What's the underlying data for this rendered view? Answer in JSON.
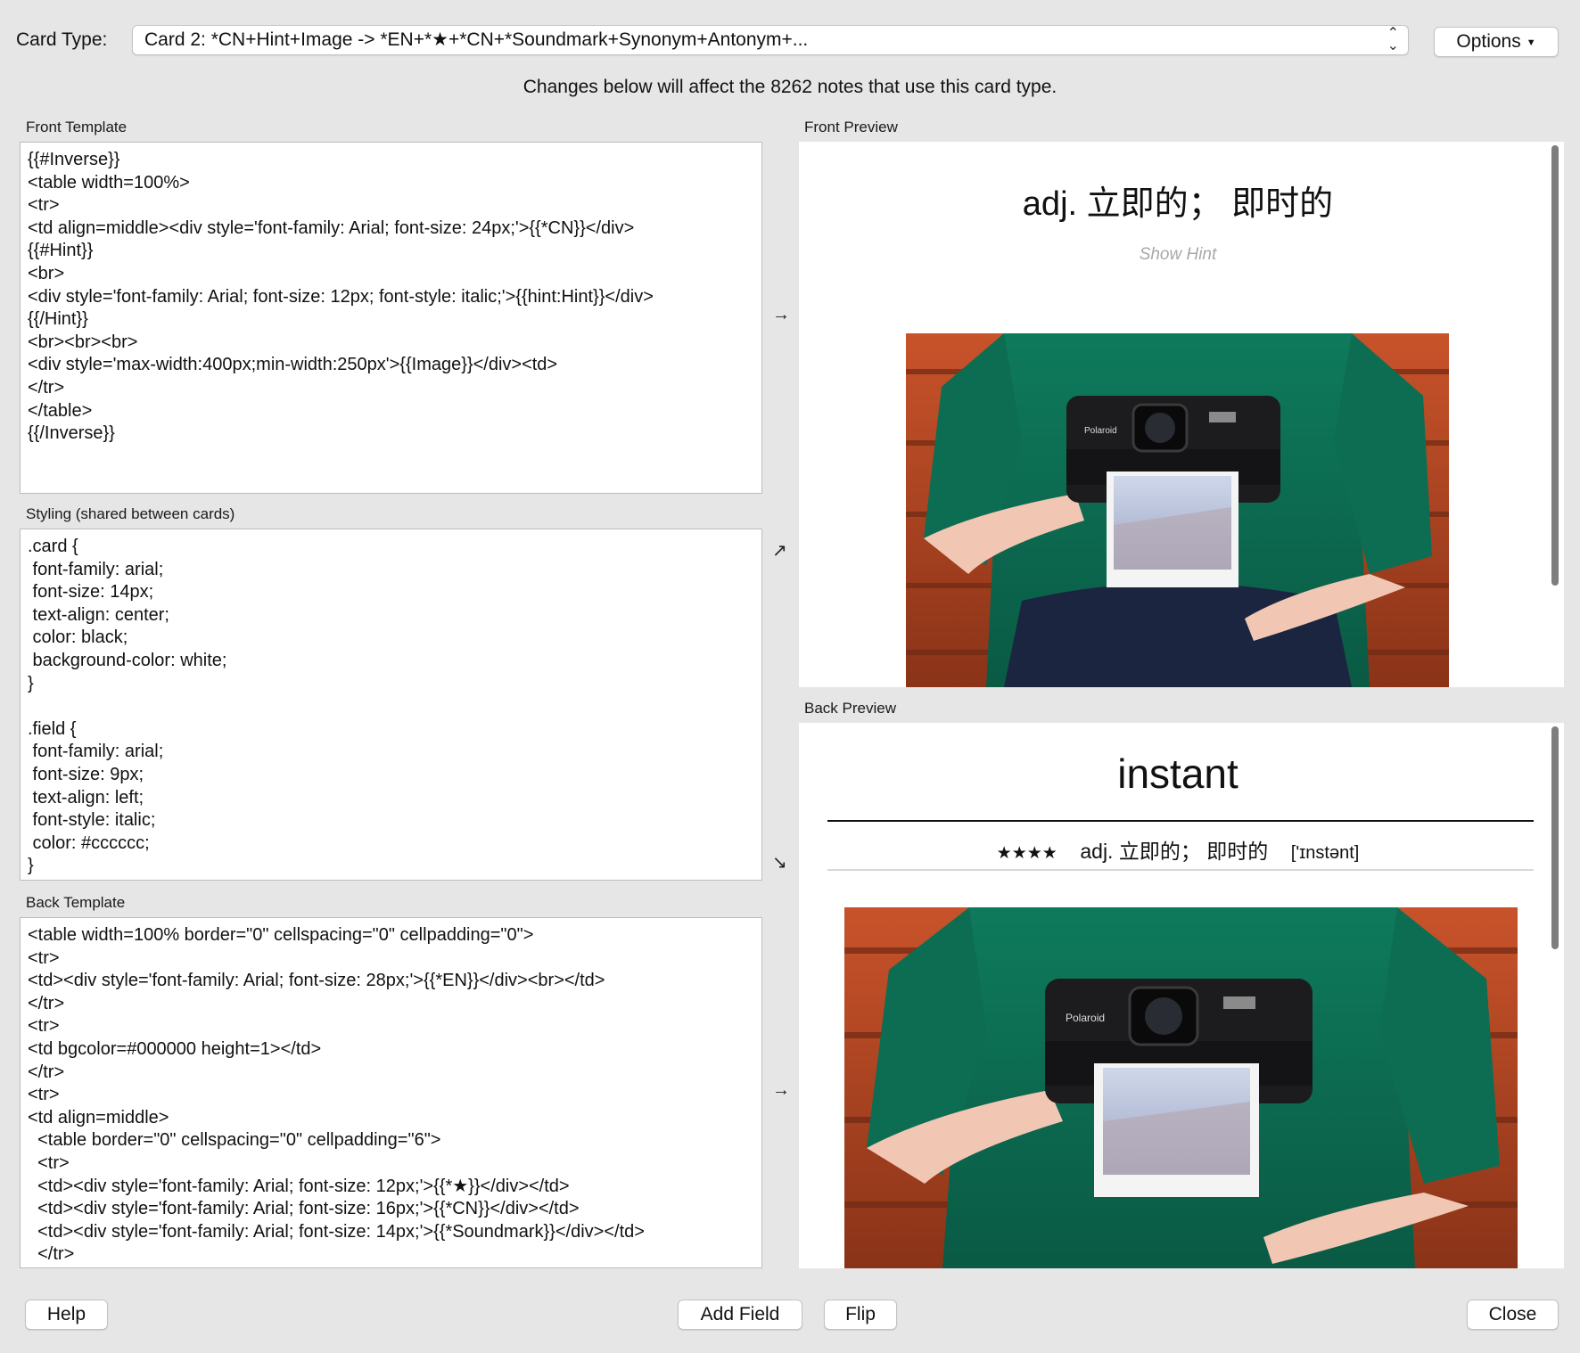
{
  "header": {
    "card_type_label": "Card Type:",
    "card_type_value": "Card 2: *CN+Hint+Image -> *EN+*★+*CN+*Soundmark+Synonym+Antonym+...",
    "options_label": "Options",
    "notice": "Changes below will affect the 8262 notes that use this card type."
  },
  "front_template": {
    "label": "Front Template",
    "lines": [
      "{{#Inverse}}",
      "<table width=100%>",
      "<tr>",
      "<td align=middle><div style='font-family: Arial; font-size: 24px;'>{{*CN}}</div>",
      "{{#Hint}}",
      "<br>",
      "<div style='font-family: Arial; font-size: 12px; font-style: italic;'>{{hint:Hint}}</div>",
      "{{/Hint}}",
      "<br><br><br>",
      "<div style='max-width:400px;min-width:250px'>{{Image}}</div><td>",
      "</tr>",
      "</table>",
      "{{/Inverse}}"
    ]
  },
  "styling": {
    "label": "Styling (shared between cards)",
    "lines": [
      ".card {",
      " font-family: arial;",
      " font-size: 14px;",
      " text-align: center;",
      " color: black;",
      " background-color: white;",
      "}",
      "",
      ".field {",
      " font-family: arial;",
      " font-size: 9px;",
      " text-align: left;",
      " font-style: italic;",
      " color: #cccccc;",
      "}"
    ]
  },
  "back_template": {
    "label": "Back Template",
    "lines": [
      "<table width=100% border=\"0\" cellspacing=\"0\" cellpadding=\"0\">",
      "<tr>",
      "<td><div style='font-family: Arial; font-size: 28px;'>{{*EN}}</div><br></td>",
      "</tr>",
      "<tr>",
      "<td bgcolor=#000000 height=1></td>",
      "</tr>",
      "<tr>",
      "<td align=middle>",
      "  <table border=\"0\" cellspacing=\"0\" cellpadding=\"6\">",
      "  <tr>",
      "  <td><div style='font-family: Arial; font-size: 12px;'>{{*★}}</div></td>",
      "  <td><div style='font-family: Arial; font-size: 16px;'>{{*CN}}</div></td>",
      "  <td><div style='font-family: Arial; font-size: 14px;'>{{*Soundmark}}</div></td>",
      "  </tr>"
    ]
  },
  "arrows": {
    "front": "→",
    "styling_up": "↗",
    "styling_down": "↘",
    "back": "→"
  },
  "front_preview": {
    "label": "Front Preview",
    "cn": "adj. 立即的； 即时的",
    "hint": "Show Hint"
  },
  "back_preview": {
    "label": "Back Preview",
    "en": "instant",
    "stars": "★★★★",
    "cn": "adj. 立即的； 即时的",
    "soundmark": "['ɪnstənt]"
  },
  "photo": {
    "camera_brand": "Polaroid"
  },
  "footer": {
    "help": "Help",
    "add_field": "Add Field",
    "flip": "Flip",
    "close": "Close"
  }
}
